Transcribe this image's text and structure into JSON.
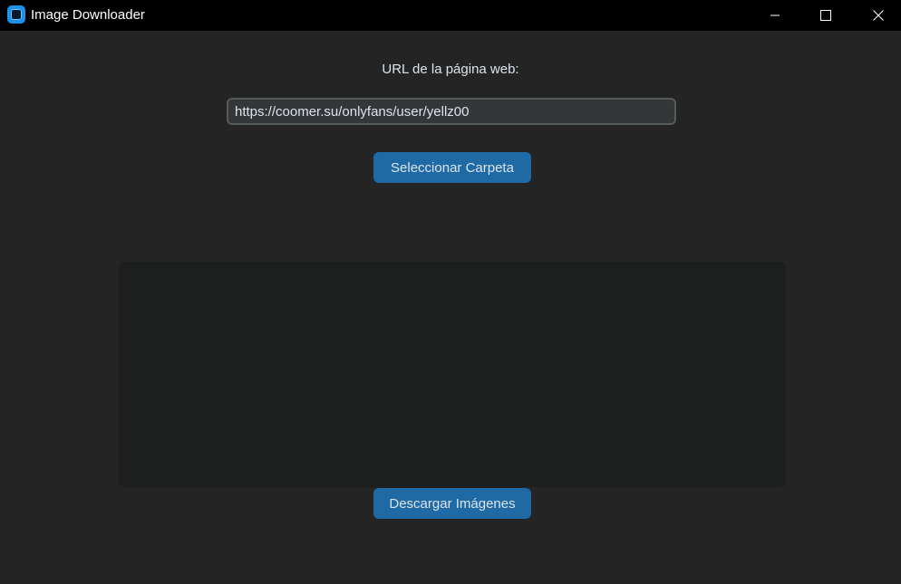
{
  "window": {
    "title": "Image Downloader"
  },
  "form": {
    "url_label": "URL de la página web:",
    "url_value": "https://coomer.su/onlyfans/user/yellz00",
    "select_folder_label": "Seleccionar Carpeta",
    "download_label": "Descargar Imágenes"
  },
  "colors": {
    "background": "#242424",
    "titlebar": "#000000",
    "accent": "#1f6aa5",
    "input_bg": "#343638",
    "log_bg": "#1d1e1e"
  },
  "icons": {
    "app": "app-icon",
    "minimize": "minimize-icon",
    "maximize": "maximize-icon",
    "close": "close-icon"
  }
}
